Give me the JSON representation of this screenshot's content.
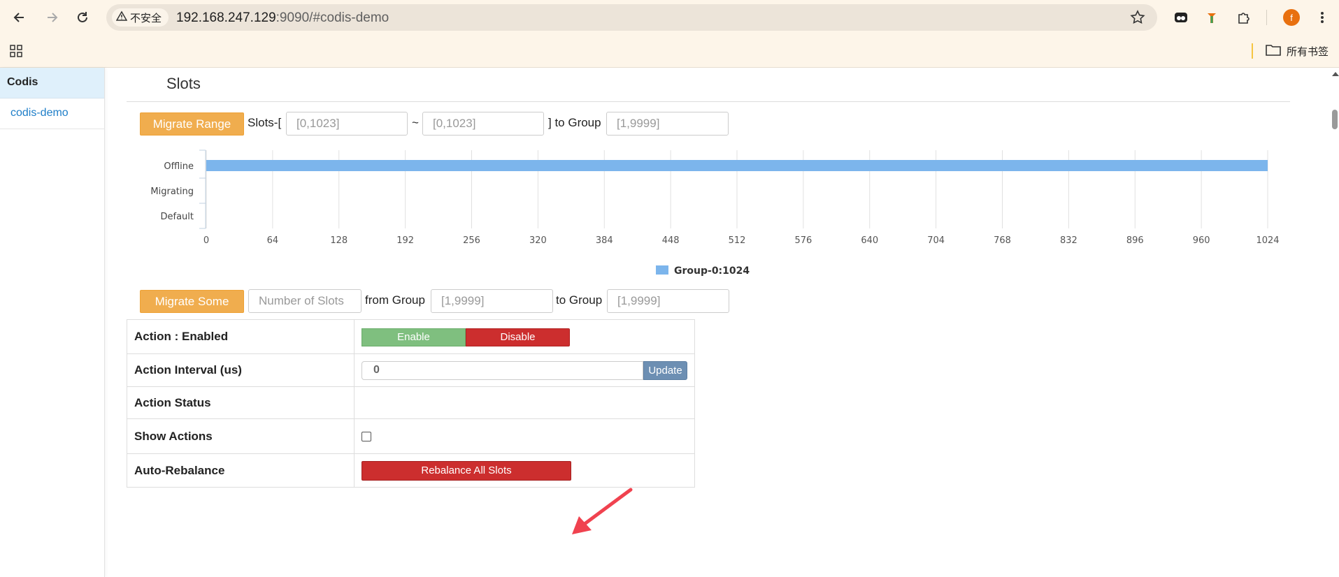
{
  "browser": {
    "security_label": "不安全",
    "url_host": "192.168.247.129",
    "url_path": ":9090/#codis-demo",
    "avatar_letter": "f",
    "bookmarks_folder": "所有书签",
    "icons": [
      "back-icon",
      "forward-icon",
      "reload-icon",
      "warning-icon",
      "star-icon",
      "extension-icon",
      "puzzle-icon",
      "menu-icon",
      "apps-icon",
      "folder-icon"
    ]
  },
  "sidebar": {
    "header": "Codis",
    "items": [
      {
        "label": "codis-demo"
      }
    ]
  },
  "main": {
    "title": "Slots",
    "migrate_range": {
      "button": "Migrate Range",
      "slots_prefix": "Slots-[",
      "from_placeholder": "[0,1023]",
      "tilde": "~",
      "to_placeholder": "[0,1023]",
      "to_group_label": "] to Group",
      "group_placeholder": "[1,9999]"
    },
    "migrate_some": {
      "button": "Migrate Some",
      "count_placeholder": "Number of Slots",
      "from_group_label": "from Group",
      "from_placeholder": "[1,9999]",
      "to_group_label": "to Group",
      "to_placeholder": "[1,9999]"
    },
    "actions": {
      "enabled_label": "Action : Enabled",
      "enable_button": "Enable",
      "disable_button": "Disable",
      "interval_label": "Action Interval (us)",
      "interval_value": "0",
      "update_button": "Update",
      "status_label": "Action Status",
      "status_value": "",
      "show_actions_label": "Show Actions",
      "show_actions_checked": false,
      "auto_rebalance_label": "Auto-Rebalance",
      "rebalance_button": "Rebalance All Slots"
    },
    "annotation_color": "#f0424f"
  },
  "chart_data": {
    "type": "bar",
    "orientation": "horizontal",
    "stacked": true,
    "categories": [
      "Offline",
      "Migrating",
      "Default"
    ],
    "x_ticks": [
      "0",
      "64",
      "128",
      "192",
      "256",
      "320",
      "384",
      "448",
      "512",
      "576",
      "640",
      "704",
      "768",
      "832",
      "896",
      "960",
      "1024"
    ],
    "xlim": [
      0,
      1024
    ],
    "series": [
      {
        "name": "Group-0:1024",
        "color": "#7cb5ec",
        "values": [
          [
            0,
            1024
          ],
          null,
          null
        ]
      }
    ],
    "legend_position": "bottom-center",
    "grid": true
  }
}
